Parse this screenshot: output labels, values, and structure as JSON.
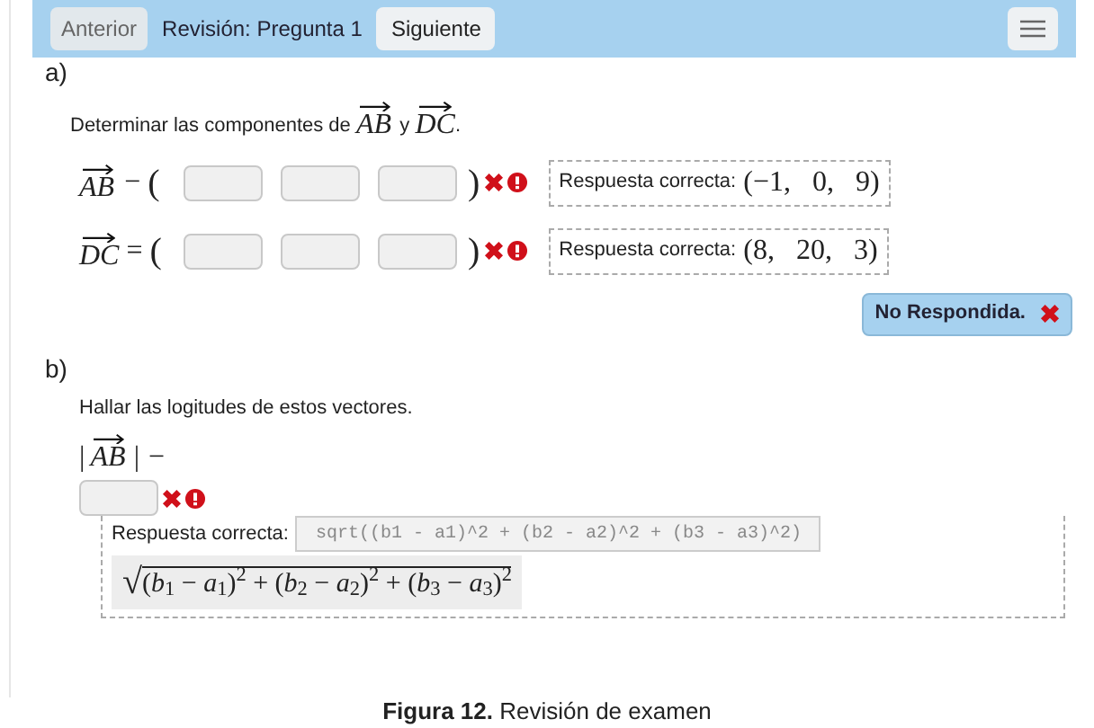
{
  "nav": {
    "prev": "Anterior",
    "title": "Revisión: Pregunta 1",
    "next": "Siguiente"
  },
  "part_a": {
    "label": "a)",
    "prompt": [
      {
        "kind": "text",
        "t": "Determinar las componentes de "
      },
      {
        "kind": "vec",
        "t": "AB"
      },
      {
        "kind": "text",
        "t": " y "
      },
      {
        "kind": "vec",
        "t": "DC"
      },
      {
        "kind": "text",
        "t": "."
      }
    ],
    "rows": [
      {
        "vector": "AB",
        "operator": "−",
        "open": "(",
        "close": ")",
        "wrong": true,
        "warning": true,
        "answer_label": "Respuesta correcta:",
        "answer_open": "(",
        "answer": [
          "−1,",
          "0,",
          "9"
        ],
        "answer_close": ")"
      },
      {
        "vector": "DC",
        "operator": "=",
        "open": "(",
        "close": ")",
        "wrong": true,
        "warning": true,
        "answer_label": "Respuesta correcta:",
        "answer_open": "(",
        "answer": [
          "8,",
          "20,",
          "3"
        ],
        "answer_close": ")"
      }
    ],
    "status": {
      "text": "No Respondida.",
      "wrong": true
    }
  },
  "part_b": {
    "label": "b)",
    "prompt": "Hallar las logitudes de estos vectores.",
    "expr_open": "|",
    "vector": "AB",
    "expr_close": "|",
    "operator": "−",
    "wrong": true,
    "warning": true,
    "answer_label": "Respuesta correcta:",
    "answer_code": "sqrt((b1 - a1)^2 + (b2 - a2)^2 + (b3 - a3)^2)",
    "radical": "√",
    "answer_math": "(*b*$_{1}$ − *a*$_{1}$)$^{2}$ + (*b*$_{2}$ − *a*$_{2}$)$^{2}$ + (*b*$_{3}$ − *a*$_{3}$)$^{2}$"
  },
  "caption": "**Figura 12.** Revisión de examen"
}
